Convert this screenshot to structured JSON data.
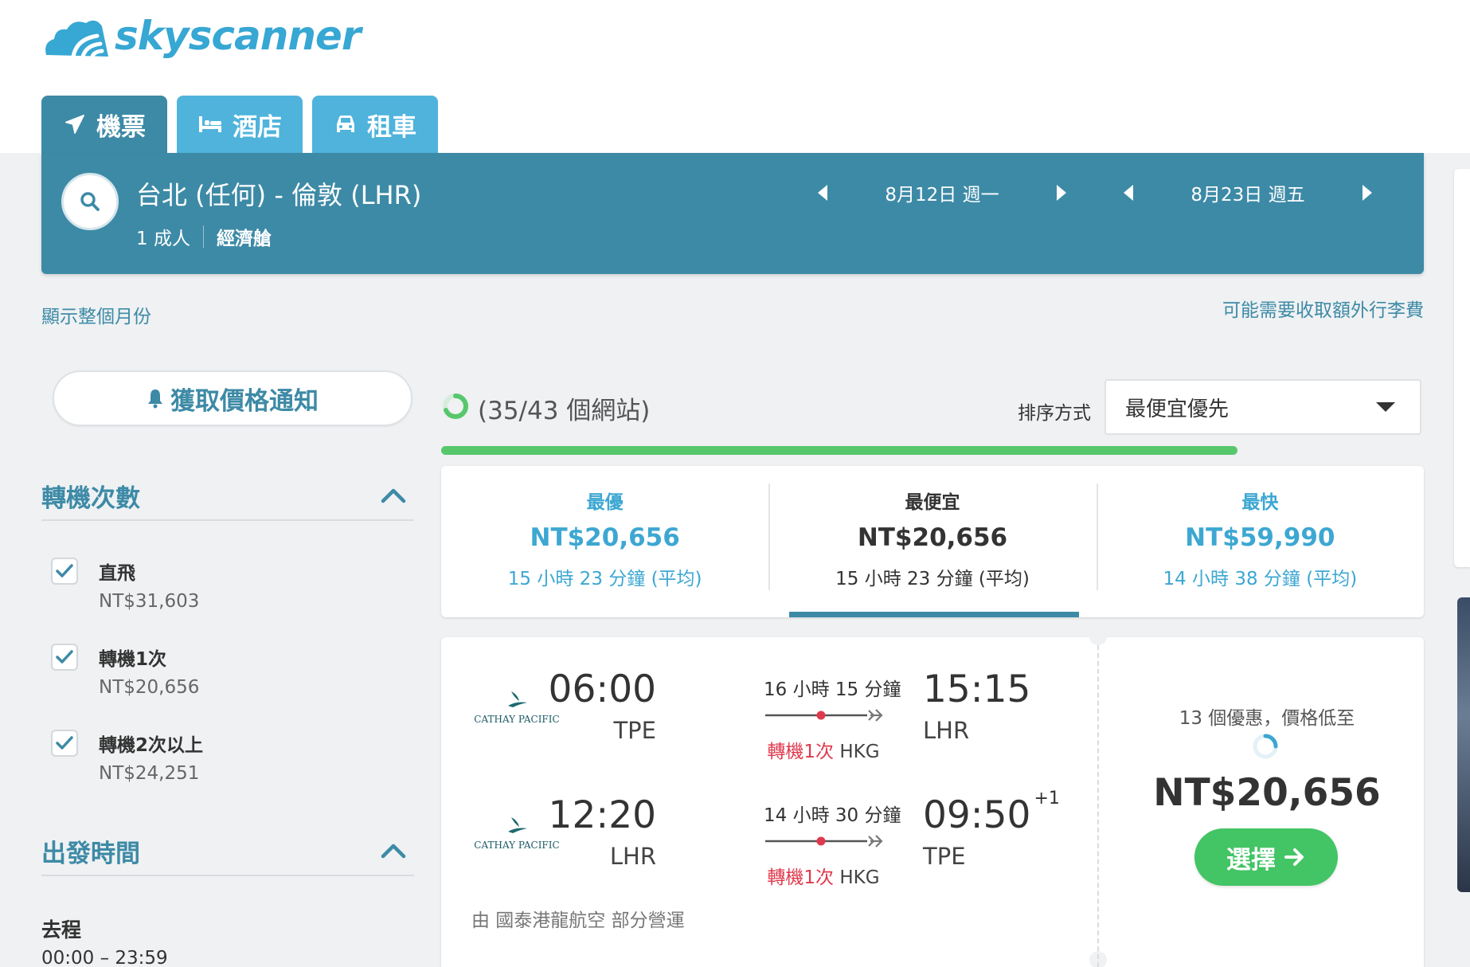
{
  "brand": {
    "name": "skyscanner",
    "color": "#37a7d3"
  },
  "tabs": [
    {
      "label": "機票",
      "icon": "plane-icon",
      "active": true
    },
    {
      "label": "酒店",
      "icon": "bed-icon",
      "active": false
    },
    {
      "label": "租車",
      "icon": "car-icon",
      "active": false
    }
  ],
  "search": {
    "route": "台北 (任何) - 倫敦 (LHR)",
    "passengers": "1 成人",
    "cabin": "經濟艙",
    "depart_date": "8月12日 週一",
    "return_date": "8月23日 週五"
  },
  "links": {
    "show_month": "顯示整個月份",
    "baggage": "可能需要收取額外行李費"
  },
  "sidebar": {
    "alert_label": "獲取價格通知",
    "stops_title": "轉機次數",
    "stops": [
      {
        "label": "直飛",
        "price": "NT$31,603",
        "checked": true
      },
      {
        "label": "轉機1次",
        "price": "NT$20,656",
        "checked": true
      },
      {
        "label": "轉機2次以上",
        "price": "NT$24,251",
        "checked": true
      }
    ],
    "departure_title": "出發時間",
    "outbound_label": "去程",
    "outbound_range": "00:00 – 23:59"
  },
  "results": {
    "site_count": "(35/43 個網站)",
    "sort_label": "排序方式",
    "sort_value": "最便宜優先",
    "progress_percent": 84
  },
  "summary": [
    {
      "heading": "最優",
      "price": "NT$20,656",
      "duration": "15 小時 23 分鐘 (平均)"
    },
    {
      "heading": "最便宜",
      "price": "NT$20,656",
      "duration": "15 小時 23 分鐘 (平均)"
    },
    {
      "heading": "最快",
      "price": "NT$59,990",
      "duration": "14 小時 38 分鐘 (平均)"
    }
  ],
  "flight": {
    "legs": [
      {
        "airline": "CATHAY PACIFIC",
        "dep_time": "06:00",
        "dep_code": "TPE",
        "duration": "16 小時 15 分鐘",
        "stops": "轉機1次",
        "hub": "HKG",
        "arr_time": "15:15",
        "arr_code": "LHR",
        "day_offset": ""
      },
      {
        "airline": "CATHAY PACIFIC",
        "dep_time": "12:20",
        "dep_code": "LHR",
        "duration": "14 小時 30 分鐘",
        "stops": "轉機1次",
        "hub": "HKG",
        "arr_time": "09:50",
        "arr_code": "TPE",
        "day_offset": "+1"
      }
    ],
    "operated_by": "由 國泰港龍航空 部分營運",
    "deals_text": "13 個優惠，價格低至",
    "price": "NT$20,656",
    "select_label": "選擇"
  },
  "colors": {
    "header_bar": "#3d8aa6",
    "tab_inactive": "#4fb3dc",
    "accent_blue": "#3da7d2",
    "progress_green": "#57c76b",
    "select_green": "#43c465",
    "stop_red": "#e0394d"
  }
}
